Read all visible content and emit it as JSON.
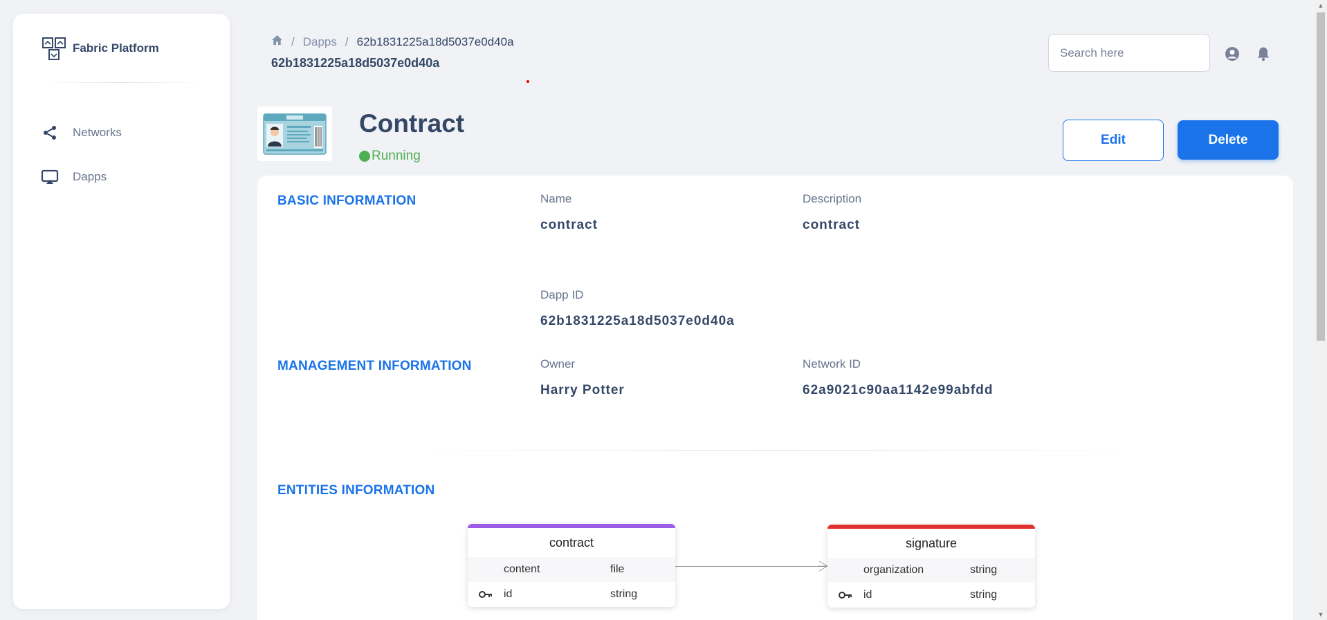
{
  "sidebar": {
    "brand": "Fabric Platform",
    "items": [
      {
        "label": "Networks",
        "icon": "share-icon"
      },
      {
        "label": "Dapps",
        "icon": "airplay-icon"
      }
    ]
  },
  "header": {
    "breadcrumb": [
      "Dapps",
      "62b1831225a18d5037e0d40a"
    ],
    "subtitle": "62b1831225a18d5037e0d40a",
    "search_placeholder": "Search here"
  },
  "app": {
    "title": "Contract",
    "status": "Running",
    "edit_label": "Edit",
    "delete_label": "Delete"
  },
  "basic": {
    "section_title": "BASIC INFORMATION",
    "name_label": "Name",
    "name_value": "contract",
    "description_label": "Description",
    "description_value": "contract",
    "dapp_id_label": "Dapp ID",
    "dapp_id_value": "62b1831225a18d5037e0d40a"
  },
  "management": {
    "section_title": "MANAGEMENT INFORMATION",
    "owner_label": "Owner",
    "owner_value": "Harry Potter",
    "network_label": "Network ID",
    "network_value": "62a9021c90aa1142e99abfdd"
  },
  "entities": {
    "section_title": "ENTITIES INFORMATION",
    "items": [
      {
        "name": "contract",
        "color": "#9c5ce6",
        "fields": [
          {
            "name": "content",
            "type": "file",
            "key": false
          },
          {
            "name": "id",
            "type": "string",
            "key": true
          }
        ]
      },
      {
        "name": "signature",
        "color": "#e03131",
        "fields": [
          {
            "name": "organization",
            "type": "string",
            "key": false
          },
          {
            "name": "id",
            "type": "string",
            "key": true
          }
        ]
      }
    ]
  },
  "colors": {
    "accent": "#1a73e8",
    "status": "#4caf50",
    "text": "#344767"
  }
}
